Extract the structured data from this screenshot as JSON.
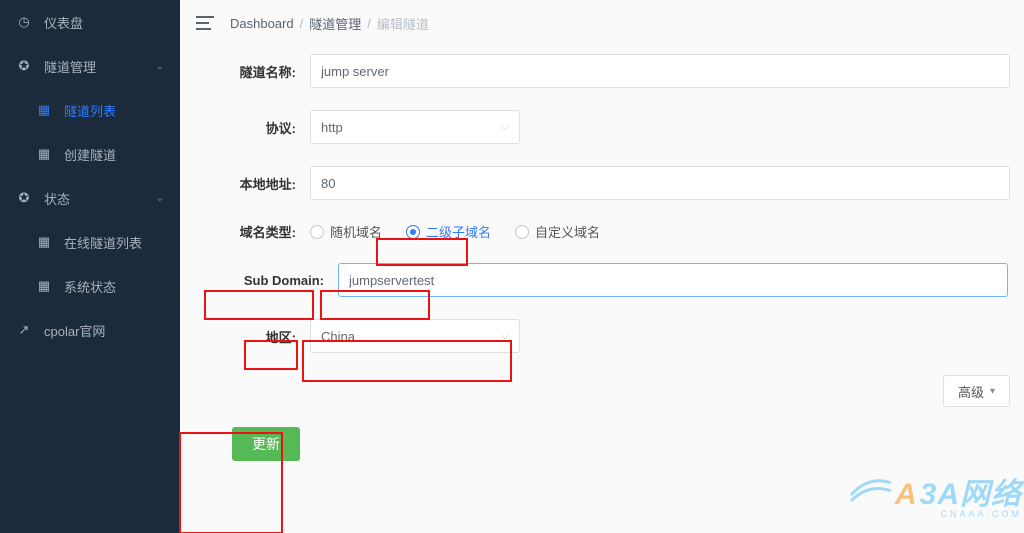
{
  "sidebar": {
    "items": [
      {
        "label": "仪表盘",
        "icon": "gauge"
      },
      {
        "label": "隧道管理",
        "icon": "plug",
        "expandable": true
      },
      {
        "label": "隧道列表",
        "icon": "grid",
        "sub": true,
        "active": true
      },
      {
        "label": "创建隧道",
        "icon": "grid",
        "sub": true
      },
      {
        "label": "状态",
        "icon": "plug",
        "expandable": true
      },
      {
        "label": "在线隧道列表",
        "icon": "grid",
        "sub": true
      },
      {
        "label": "系统状态",
        "icon": "grid",
        "sub": true
      },
      {
        "label": "cpolar官网",
        "icon": "external"
      }
    ]
  },
  "breadcrumb": {
    "a": "Dashboard",
    "b": "隧道管理",
    "c": "编辑隧道"
  },
  "form": {
    "name_label": "隧道名称:",
    "name_value": "jump server",
    "proto_label": "协议:",
    "proto_value": "http",
    "addr_label": "本地地址:",
    "addr_value": "80",
    "domaintype_label": "域名类型:",
    "domaintype_options": {
      "random": "随机域名",
      "sub": "二级子域名",
      "custom": "自定义域名"
    },
    "subdomain_label": "Sub Domain:",
    "subdomain_value": "jumpservertest",
    "region_label": "地区:",
    "region_value": "China",
    "advanced_label": "高级",
    "submit_label": "更新"
  },
  "watermark": {
    "main_a": "A",
    "main_b": "3A网络",
    "sub": "CNAAA.COM"
  }
}
